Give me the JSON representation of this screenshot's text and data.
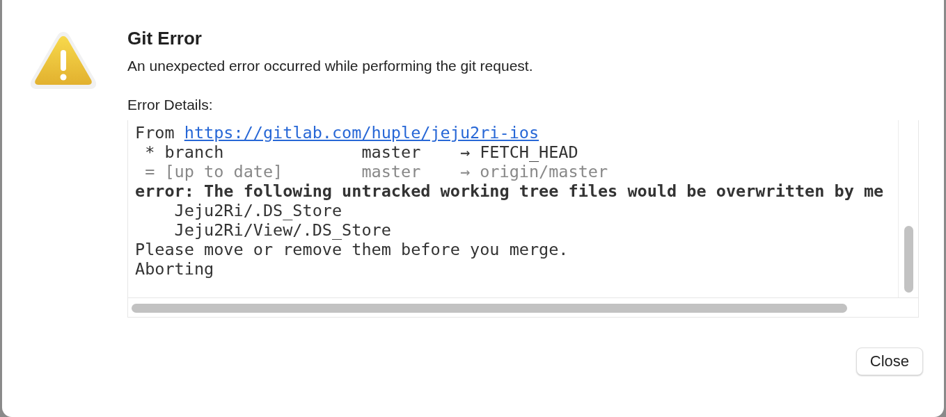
{
  "dialog": {
    "title": "Git Error",
    "message": "An unexpected error occurred while performing the git request.",
    "details_label": "Error Details:",
    "log": [
      {
        "kind": "link",
        "text": "From ",
        "link": "https://gitlab.com/huple/jeju2ri-ios"
      },
      {
        "kind": "plain",
        "text": " * branch              master    → FETCH_HEAD"
      },
      {
        "kind": "dim",
        "text": " = [up to date]        master    → origin/master"
      },
      {
        "kind": "bold",
        "text": "error: The following untracked working tree files would be overwritten by me"
      },
      {
        "kind": "plain",
        "text": "    Jeju2Ri/.DS_Store"
      },
      {
        "kind": "plain",
        "text": "    Jeju2Ri/View/.DS_Store"
      },
      {
        "kind": "plain",
        "text": "Please move or remove them before you merge."
      },
      {
        "kind": "plain",
        "text": "Aborting"
      }
    ],
    "buttons": [
      "Close"
    ]
  }
}
